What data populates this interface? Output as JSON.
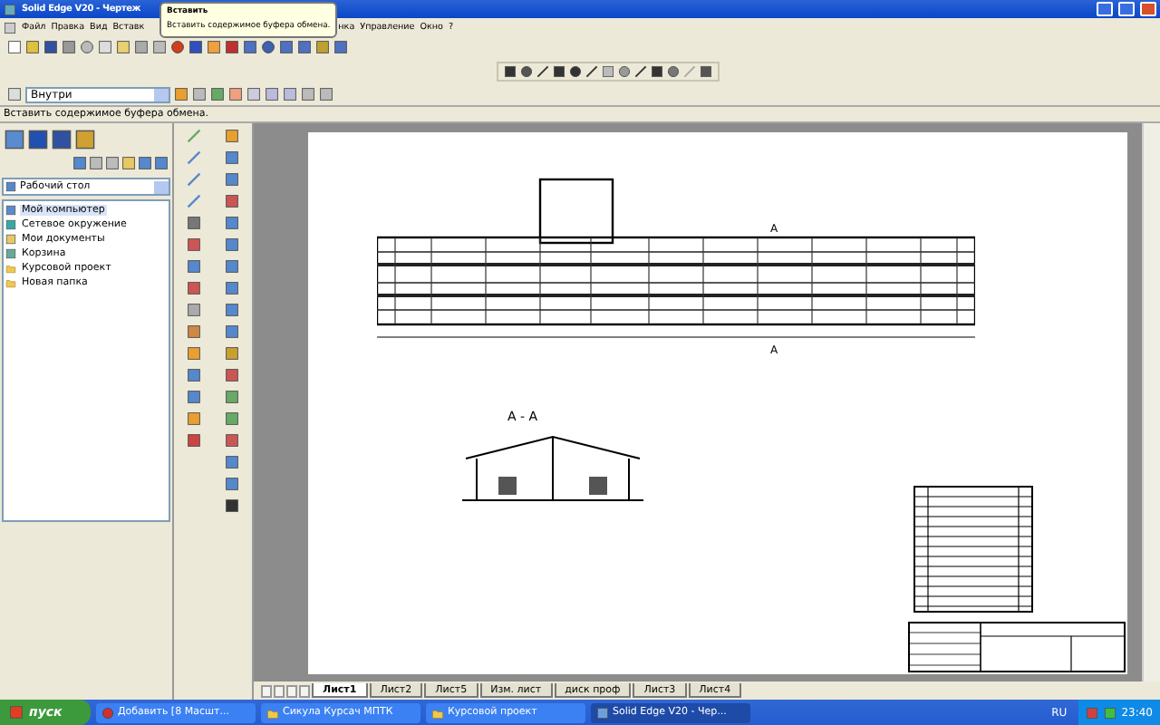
{
  "window": {
    "title": "Solid Edge V20 - Чертеж"
  },
  "menu": [
    {
      "label": "Файл"
    },
    {
      "label": "Правка"
    },
    {
      "label": "Вид"
    },
    {
      "label": "Вставк",
      "covered": true
    },
    {
      "label": "нка"
    },
    {
      "label": "Управление"
    },
    {
      "label": "Окно"
    },
    {
      "label": "?"
    }
  ],
  "tooltip": {
    "title": "Вставить",
    "text": "Вставить содержимое буфера обмена."
  },
  "ribbon": {
    "dropdown": "Внутри"
  },
  "status_bar": "Вставить содержимое буфера обмена.",
  "explorer": {
    "location": "Рабочий стол",
    "items": [
      {
        "label": "Мой компьютер",
        "kind": "computer",
        "selected": true
      },
      {
        "label": "Сетевое окружение",
        "kind": "network",
        "selected": false
      },
      {
        "label": "Мои документы",
        "kind": "documents",
        "selected": false
      },
      {
        "label": "Корзина",
        "kind": "bin",
        "selected": false
      },
      {
        "label": "Курсовой проект",
        "kind": "folder",
        "selected": false
      },
      {
        "label": "Новая папка",
        "kind": "folder",
        "selected": false
      }
    ]
  },
  "drawing": {
    "section_label": "А - А",
    "cut_labels": [
      "А",
      "А"
    ]
  },
  "sheet_tabs": [
    {
      "label": "Лист1",
      "selected": true
    },
    {
      "label": "Лист2",
      "selected": false
    },
    {
      "label": "Лист5",
      "selected": false
    },
    {
      "label": "Изм. лист",
      "selected": false
    },
    {
      "label": "диск проф",
      "selected": false
    },
    {
      "label": "Лист3",
      "selected": false
    },
    {
      "label": "Лист4",
      "selected": false
    }
  ],
  "taskbar": {
    "start": "пуск",
    "tasks": [
      {
        "label": "Добавить [8 Масшт...",
        "kind": "browser",
        "active": false
      },
      {
        "label": "Сикула Курсач МПТК",
        "kind": "folder",
        "active": false
      },
      {
        "label": "Курсовой проект",
        "kind": "folder",
        "active": false
      },
      {
        "label": "Solid Edge V20 - Чер...",
        "kind": "app",
        "active": true
      }
    ],
    "language": "RU",
    "clock": "23:40"
  }
}
